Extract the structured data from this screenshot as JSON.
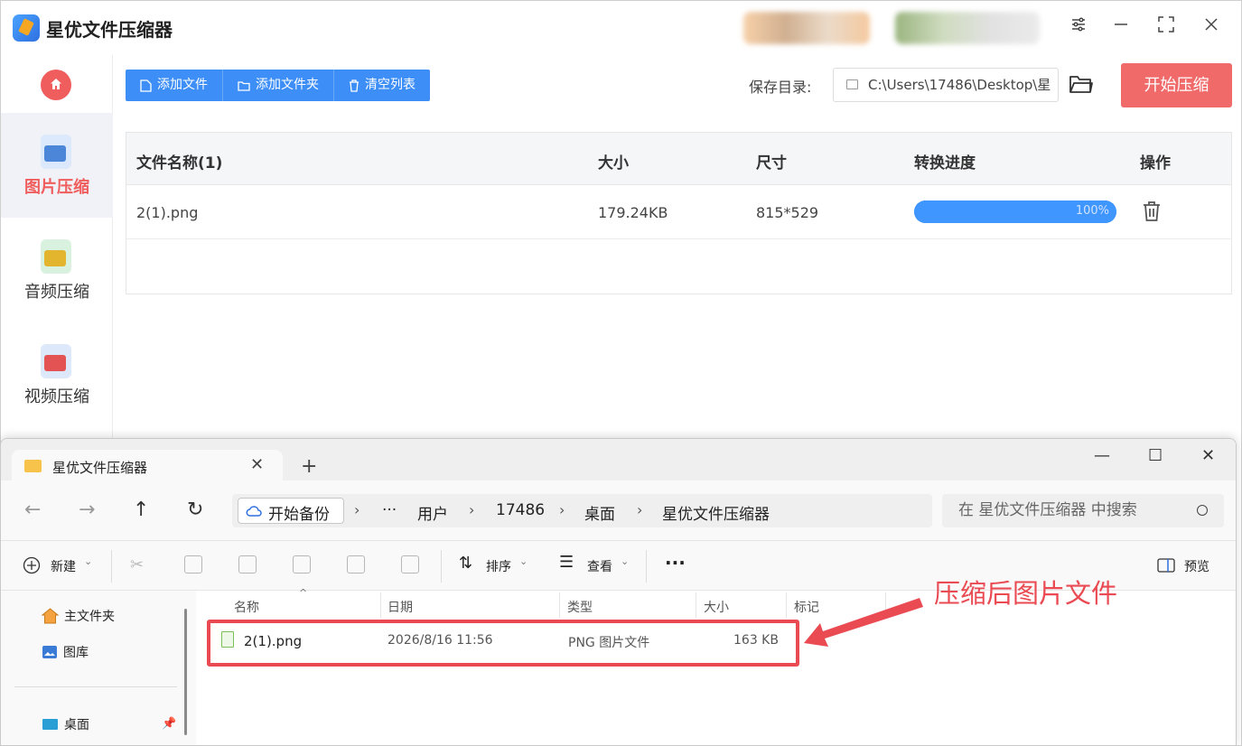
{
  "app": {
    "title": "星优文件压缩器",
    "accent_color": "#3d8ef7",
    "danger_color": "#f06a6a",
    "sidebar": {
      "items": [
        {
          "label": "图片压缩",
          "icon": "image-compress-icon",
          "active": true
        },
        {
          "label": "音频压缩",
          "icon": "audio-compress-icon",
          "active": false
        },
        {
          "label": "视频压缩",
          "icon": "video-compress-icon",
          "active": false
        }
      ]
    },
    "toolbar": {
      "add_file": "添加文件",
      "add_folder": "添加文件夹",
      "clear_list": "清空列表",
      "save_dir_label": "保存目录:",
      "save_dir_value": "C:\\Users\\17486\\Desktop\\星",
      "start_button": "开始压缩"
    },
    "table": {
      "headers": [
        "文件名称(1)",
        "大小",
        "尺寸",
        "转换进度",
        "操作"
      ],
      "rows": [
        {
          "name": "2(1).png",
          "size": "179.24KB",
          "dimensions": "815*529",
          "progress": 1.0,
          "progress_label": "100%"
        }
      ]
    }
  },
  "explorer": {
    "tab_title": "星优文件压缩器",
    "breadcrumb": [
      "开始备份",
      "···",
      "用户",
      "17486",
      "桌面",
      "星优文件压缩器"
    ],
    "search_placeholder": "在 星优文件压缩器 中搜索",
    "commands": {
      "new": "新建",
      "sort": "排序",
      "view": "查看",
      "more": "···",
      "preview": "预览"
    },
    "sidebar": [
      "主文件夹",
      "图库",
      "桌面"
    ],
    "columns": [
      "名称",
      "日期",
      "类型",
      "大小",
      "标记"
    ],
    "files": [
      {
        "name": "2(1).png",
        "date": "2026/8/16 11:56",
        "type": "PNG 图片文件",
        "size": "163 KB"
      }
    ]
  },
  "annotation": {
    "text": "压缩后图片文件",
    "color": "#ea4b53"
  }
}
